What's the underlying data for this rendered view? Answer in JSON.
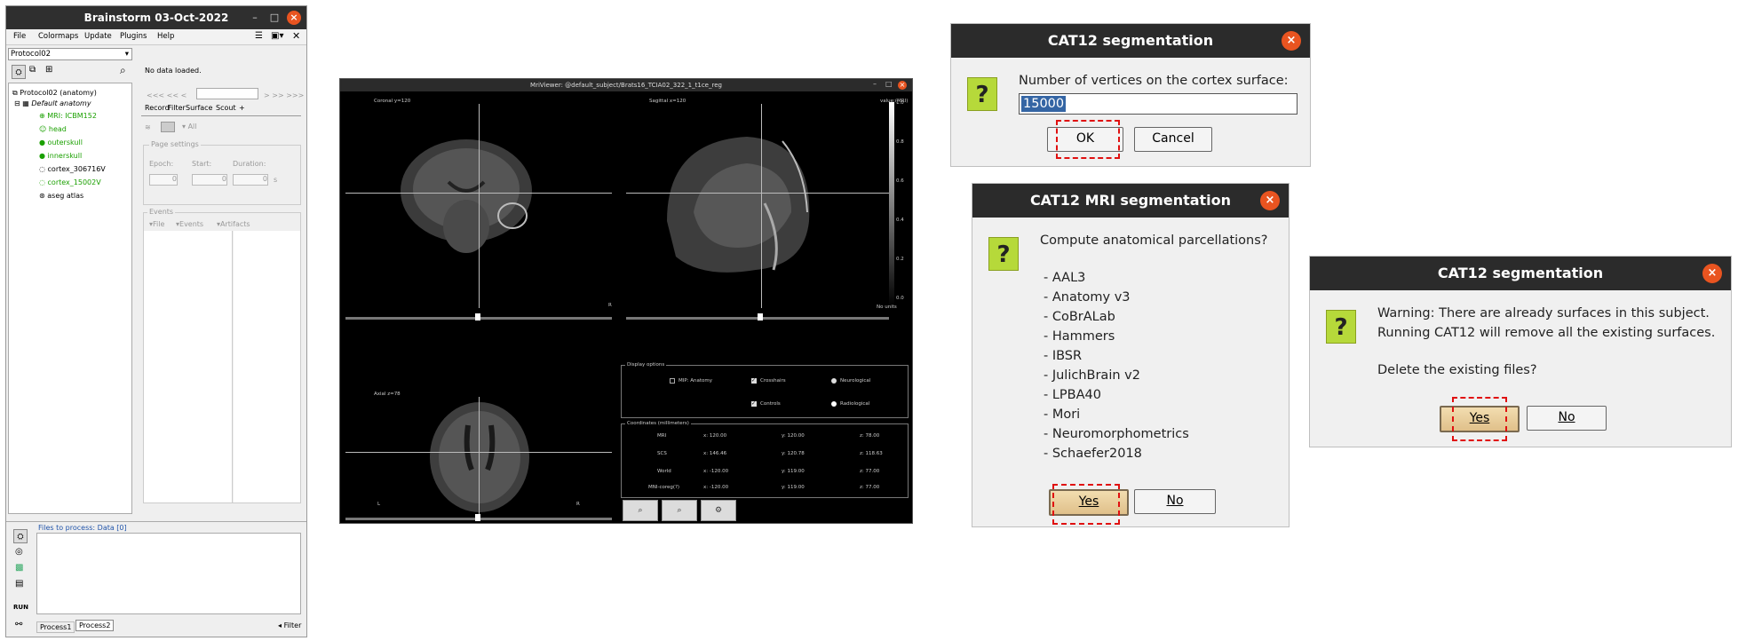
{
  "brainstorm": {
    "title": "Brainstorm 03-Oct-2022",
    "menu": [
      "File",
      "Colormaps",
      "Update",
      "Plugins",
      "Help"
    ],
    "protocol_select": "Protocol02",
    "tree_root": "Protocol02 (anatomy)",
    "tree_subject": "Default anatomy",
    "tree_items": [
      "MRI: ICBM152",
      "head",
      "outerskull",
      "innerskull",
      "cortex_306716V",
      "cortex_15002V",
      "aseg atlas"
    ],
    "no_data": "No data loaded.",
    "nav_left": "<<<  <<  <",
    "nav_right": ">  >>  >>>",
    "tabs": [
      "Record",
      "Filter",
      "Surface",
      "Scout",
      "+"
    ],
    "all_label": "All",
    "page_settings": "Page settings",
    "epoch_label": "Epoch:",
    "start_label": "Start:",
    "duration_label": "Duration:",
    "epoch_value": "0",
    "start_value": "0",
    "duration_value": "0",
    "duration_unit": "s",
    "events_label": "Events",
    "events_menu": [
      "File",
      "Events",
      "Artifacts"
    ],
    "files_to_process": "Files to process: Data [0]",
    "run_label": "RUN",
    "process_tabs": [
      "Process1",
      "Process2"
    ],
    "filter_label": "Filter"
  },
  "mri": {
    "title": "MriViewer: @default_subject/Brats16_TCIA02_322_1_t1ce_reg",
    "coronal": "Coronal    y=120",
    "sagittal": "Sagittal    x=120",
    "axial": "Axial    z=78",
    "scale_top": "1.0",
    "scale_marks": [
      "0.8",
      "0.6",
      "0.4",
      "0.2",
      "0.0"
    ],
    "no_units": "No units",
    "value_label": "value:(MRI)",
    "orient_R": "R",
    "orient_L": "L",
    "display_options": "Display options",
    "opt_mip": "MIP: Anatomy",
    "opt_crosshairs": "Crosshairs",
    "opt_controls": "Controls",
    "opt_neuro": "Neurological",
    "opt_radio": "Radiological",
    "coords_title": "Coordinates (millimeters)",
    "coord_rows": [
      {
        "label": "MRI",
        "x": "x: 120.00",
        "y": "y: 120.00",
        "z": "z: 78.00"
      },
      {
        "label": "SCS",
        "x": "x: 146.46",
        "y": "y: 120.78",
        "z": "z: 118.63"
      },
      {
        "label": "World",
        "x": "x: -120.00",
        "y": "y: 119.00",
        "z": "z: 77.00"
      },
      {
        "label": "MNI-coreg(?)",
        "x": "x: -120.00",
        "y": "y: 119.00",
        "z": "z: 77.00"
      }
    ],
    "btn_zoom_in": "⌕",
    "btn_zoom_out": "⌕",
    "btn_settings": "⚙"
  },
  "dialog1": {
    "title": "CAT12 segmentation",
    "prompt": "Number of vertices on the cortex surface:",
    "value": "15000",
    "ok": "OK",
    "cancel": "Cancel"
  },
  "dialog2": {
    "title": "CAT12 MRI segmentation",
    "prompt": "Compute anatomical parcellations?",
    "items": [
      "- AAL3",
      "- Anatomy v3",
      "- CoBrALab",
      "- Hammers",
      "- IBSR",
      "- JulichBrain v2",
      "- LPBA40",
      "- Mori",
      "- Neuromorphometrics",
      "- Schaefer2018"
    ],
    "yes": "Yes",
    "no": "No"
  },
  "dialog3": {
    "title": "CAT12 segmentation",
    "line1": "Warning: There are already surfaces in this subject.",
    "line2": "Running CAT12 will remove all the existing surfaces.",
    "line3": "Delete the existing files?",
    "yes": "Yes",
    "no": "No"
  },
  "colors": {
    "accent_close": "#e95420",
    "title_bar": "#2b2b2b",
    "highlight_dash": "#e01010",
    "tree_green": "#1aa000"
  }
}
